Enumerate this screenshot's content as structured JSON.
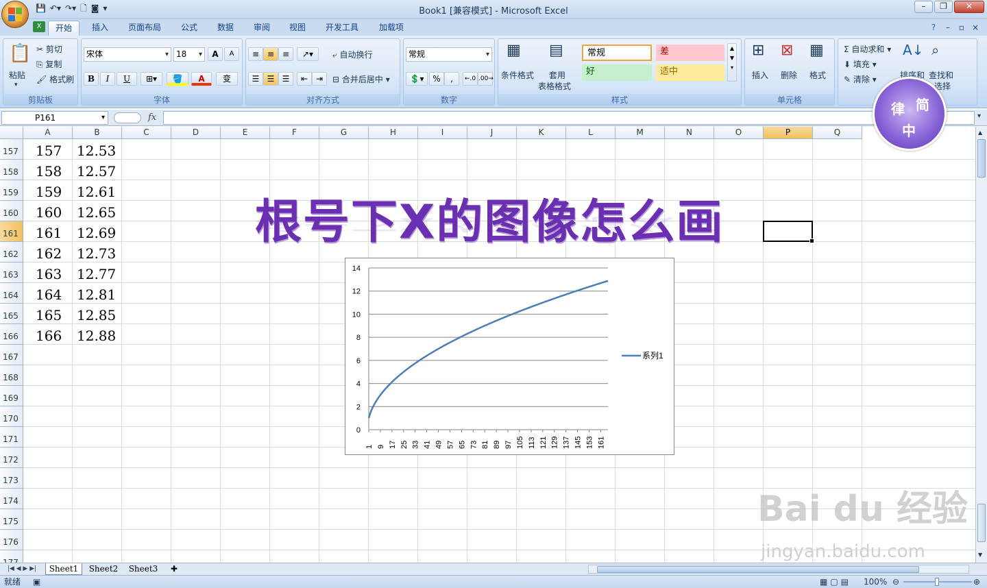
{
  "window": {
    "title": "Book1  [兼容模式] - Microsoft Excel",
    "controls": [
      "–",
      "❐",
      "✕"
    ]
  },
  "ribbon_tabs": [
    "开始",
    "插入",
    "页面布局",
    "公式",
    "数据",
    "审阅",
    "视图",
    "开发工具",
    "加载项"
  ],
  "clipboard": {
    "paste": "粘贴",
    "cut": "剪切",
    "copy": "复制",
    "format_painter": "格式刷",
    "label": "剪贴板"
  },
  "font": {
    "name": "宋体",
    "size": "18",
    "label": "字体",
    "bold": "B",
    "italic": "I",
    "underline": "U",
    "grow": "A",
    "shrink": "A",
    "font_color": "A",
    "wen": "变"
  },
  "alignment": {
    "wrap": "自动换行",
    "merge": "合并后居中",
    "label": "对齐方式"
  },
  "number": {
    "format": "常规",
    "percent": "%",
    "comma": ",",
    "label": "数字"
  },
  "styles": {
    "conditional": "条件格式",
    "table": "套用",
    "table2": "表格格式",
    "normal": "常规",
    "bad": "差",
    "good": "好",
    "neutral": "适中",
    "label": "样式"
  },
  "cells": {
    "insert": "插入",
    "delete": "删除",
    "format": "格式",
    "label": "单元格"
  },
  "editing": {
    "autosum": "自动求和",
    "fill": "填充",
    "clear": "清除",
    "sort": "排序和",
    "find": "查找和",
    "select": "选择"
  },
  "formula_bar": {
    "name_box": "P161",
    "fx": "fx",
    "formula": ""
  },
  "columns": [
    "A",
    "B",
    "C",
    "D",
    "E",
    "F",
    "G",
    "H",
    "I",
    "J",
    "K",
    "L",
    "M",
    "N",
    "O",
    "P",
    "Q"
  ],
  "selected_column": "P",
  "rows": [
    "157",
    "158",
    "159",
    "160",
    "161",
    "162",
    "163",
    "164",
    "165",
    "166",
    "167",
    "168",
    "169",
    "170",
    "171",
    "172",
    "173",
    "174",
    "175",
    "176",
    "177"
  ],
  "selected_row": "161",
  "cell_data": [
    {
      "a": "157",
      "b": "12.53"
    },
    {
      "a": "158",
      "b": "12.57"
    },
    {
      "a": "159",
      "b": "12.61"
    },
    {
      "a": "160",
      "b": "12.65"
    },
    {
      "a": "161",
      "b": "12.69"
    },
    {
      "a": "162",
      "b": "12.73"
    },
    {
      "a": "163",
      "b": "12.77"
    },
    {
      "a": "164",
      "b": "12.81"
    },
    {
      "a": "165",
      "b": "12.85"
    },
    {
      "a": "166",
      "b": "12.88"
    }
  ],
  "wordart": "根号下X的图像怎么画",
  "chart_data": {
    "type": "line",
    "x": {
      "start": 1,
      "end": 166,
      "step": 1
    },
    "x_tick_labels": [
      "1",
      "9",
      "17",
      "25",
      "33",
      "41",
      "49",
      "57",
      "65",
      "73",
      "81",
      "89",
      "97",
      "105",
      "113",
      "121",
      "129",
      "137",
      "145",
      "153",
      "161"
    ],
    "y_function": "sqrt",
    "ylim": [
      0,
      14
    ],
    "y_ticks": [
      0,
      2,
      4,
      6,
      8,
      10,
      12,
      14
    ],
    "series": [
      {
        "name": "系列1",
        "color": "#4a7ebb"
      }
    ],
    "grid": true,
    "legend": "right"
  },
  "sheets": [
    "Sheet1",
    "Sheet2",
    "Sheet3"
  ],
  "active_sheet": "Sheet1",
  "status": {
    "ready": "就绪",
    "zoom": "100%"
  },
  "badge": {
    "chars": [
      "律",
      "简",
      "中"
    ]
  },
  "watermark": {
    "brand": "Bai du 经验",
    "url": "jingyan.baidu.com"
  }
}
